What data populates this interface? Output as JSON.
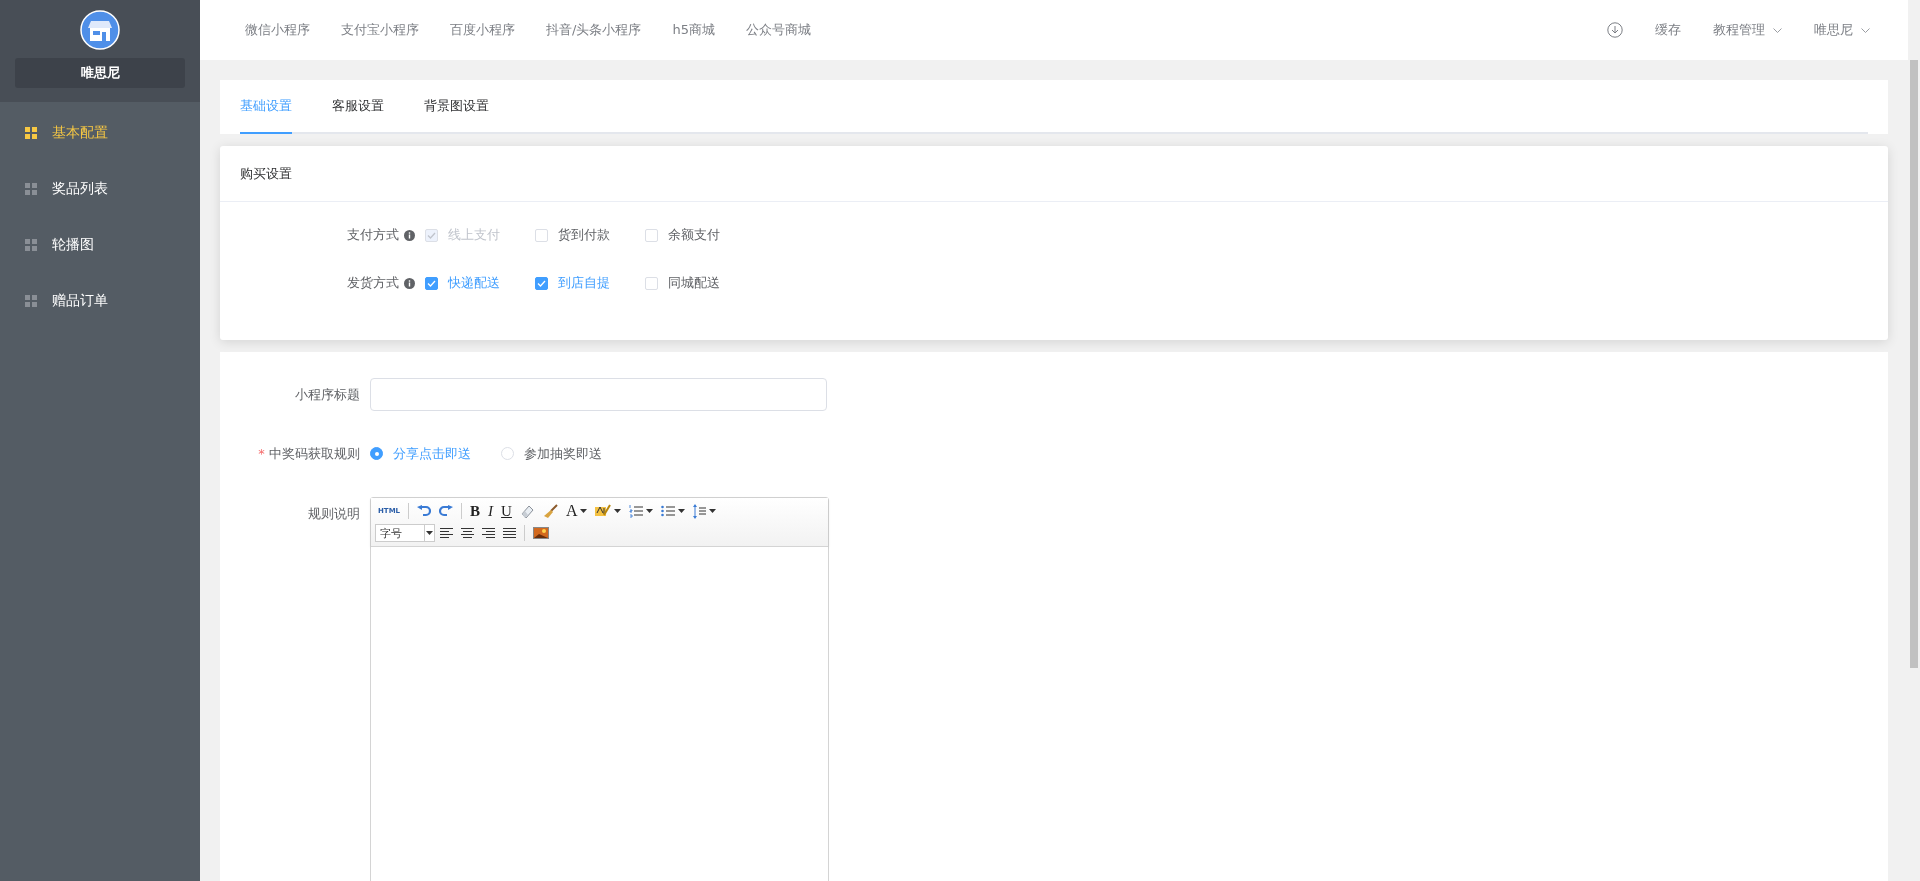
{
  "sidebar": {
    "shop_name": "唯思尼",
    "items": [
      {
        "label": "基本配置",
        "selected": true
      },
      {
        "label": "奖品列表",
        "selected": false
      },
      {
        "label": "轮播图",
        "selected": false
      },
      {
        "label": "赠品订单",
        "selected": false
      }
    ]
  },
  "top_nav": {
    "links": [
      "微信小程序",
      "支付宝小程序",
      "百度小程序",
      "抖音/头条小程序",
      "h5商城",
      "公众号商城"
    ],
    "right": [
      {
        "kind": "icon"
      },
      {
        "kind": "link",
        "label": "缓存"
      },
      {
        "kind": "dropdown",
        "label": "教程管理"
      },
      {
        "kind": "dropdown",
        "label": "唯思尼"
      }
    ]
  },
  "tabs": [
    {
      "label": "基础设置",
      "selected": true
    },
    {
      "label": "客服设置",
      "selected": false
    },
    {
      "label": "背景图设置",
      "selected": false
    }
  ],
  "purchase": {
    "title": "购买设置",
    "rows": [
      {
        "label": "支付方式",
        "options": [
          {
            "label": "线上支付",
            "checked": true,
            "disabled": true
          },
          {
            "label": "货到付款",
            "checked": false,
            "disabled": false
          },
          {
            "label": "余额支付",
            "checked": false,
            "disabled": false
          }
        ]
      },
      {
        "label": "发货方式",
        "options": [
          {
            "label": "快递配送",
            "checked": true,
            "disabled": false
          },
          {
            "label": "到店自提",
            "checked": true,
            "disabled": false
          },
          {
            "label": "同城配送",
            "checked": false,
            "disabled": false
          }
        ]
      }
    ]
  },
  "form": {
    "title_field": {
      "label": "小程序标题"
    },
    "rule": {
      "label": "中奖码获取规则",
      "required_mark": "*",
      "options": [
        {
          "label": "分享点击即送",
          "selected": true
        },
        {
          "label": "参加抽奖即送",
          "selected": false
        }
      ]
    },
    "editor": {
      "label": "规则说明",
      "font_size": "字号",
      "toolbar": [
        {
          "kind": "text",
          "label": "HTML",
          "dropdown": false
        },
        {
          "kind": "sep"
        },
        {
          "kind": "icon",
          "dropdown": false
        },
        {
          "kind": "icon",
          "dropdown": false
        },
        {
          "kind": "sep"
        },
        {
          "kind": "text",
          "label": "B",
          "dropdown": false
        },
        {
          "kind": "text",
          "label": "I",
          "dropdown": false
        },
        {
          "kind": "text",
          "label": "U",
          "dropdown": false
        },
        {
          "kind": "icon",
          "dropdown": false
        },
        {
          "kind": "icon",
          "dropdown": false
        },
        {
          "kind": "text",
          "label": "A",
          "dropdown": true
        },
        {
          "kind": "icon",
          "dropdown": true
        },
        {
          "kind": "icon",
          "dropdown": true
        },
        {
          "kind": "icon",
          "dropdown": true
        },
        {
          "kind": "icon",
          "dropdown": true
        }
      ],
      "toolbar2": [
        {
          "kind": "icon",
          "dropdown": false
        },
        {
          "kind": "icon",
          "dropdown": false
        },
        {
          "kind": "icon",
          "dropdown": false
        },
        {
          "kind": "icon",
          "dropdown": false
        },
        {
          "kind": "sep"
        },
        {
          "kind": "icon",
          "dropdown": false
        }
      ]
    }
  }
}
